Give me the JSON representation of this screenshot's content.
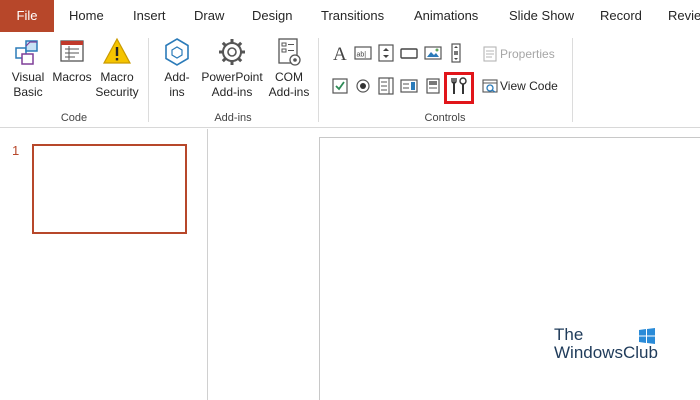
{
  "tabs": [
    "File",
    "Home",
    "Insert",
    "Draw",
    "Design",
    "Transitions",
    "Animations",
    "Slide Show",
    "Record",
    "Revie"
  ],
  "groups": {
    "code": {
      "label": "Code",
      "buttons": [
        {
          "line1": "Visual",
          "line2": "Basic",
          "icon": "visual-basic-icon"
        },
        {
          "line1": "Macros",
          "line2": "",
          "icon": "macros-icon"
        },
        {
          "line1": "Macro",
          "line2": "Security",
          "icon": "macro-security-icon"
        }
      ]
    },
    "addins": {
      "label": "Add-ins",
      "buttons": [
        {
          "line1": "Add-",
          "line2": "ins",
          "icon": "add-ins-icon"
        },
        {
          "line1": "PowerPoint",
          "line2": "Add-ins",
          "icon": "powerpoint-add-ins-icon"
        },
        {
          "line1": "COM",
          "line2": "Add-ins",
          "icon": "com-add-ins-icon"
        }
      ]
    },
    "controls": {
      "label": "Controls",
      "properties_label": "Properties",
      "view_code_label": "View Code"
    }
  },
  "slides": {
    "thumb_number": "1"
  },
  "watermark": {
    "line1": "The",
    "line2": "WindowsClub"
  },
  "colors": {
    "accent": "#b7472a",
    "highlight": "#e1151a"
  }
}
